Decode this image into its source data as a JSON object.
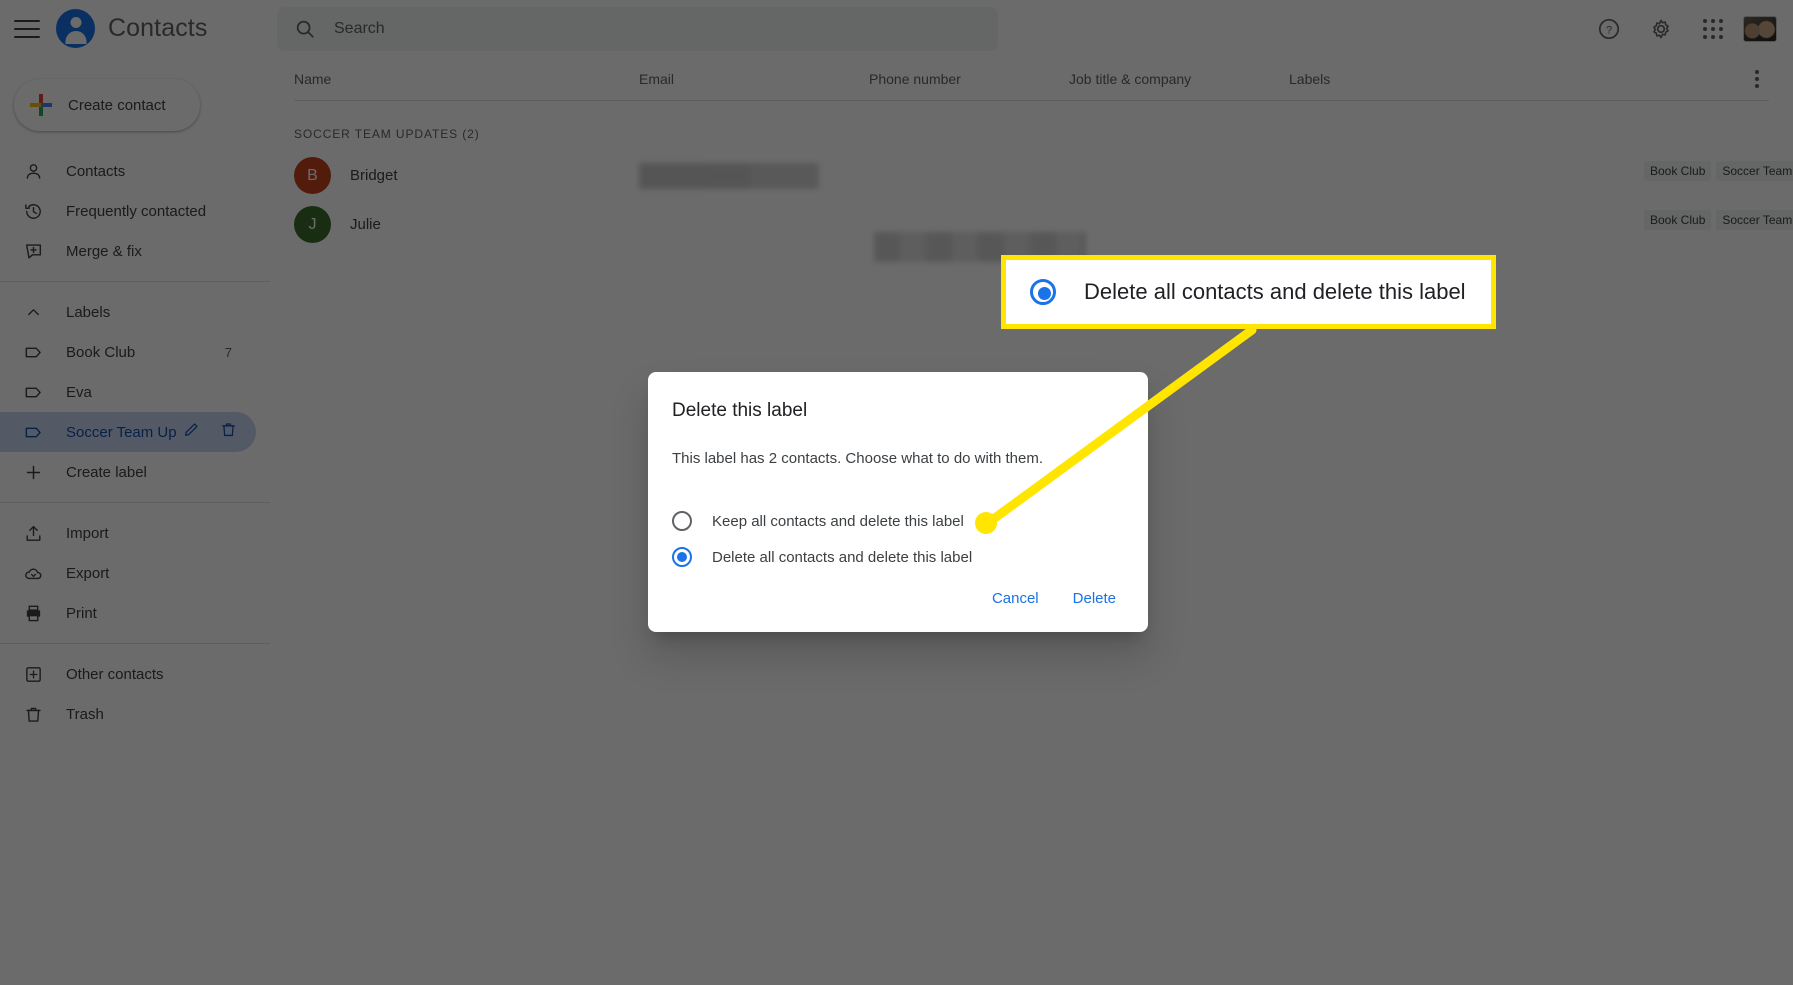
{
  "app": {
    "title": "Contacts",
    "menu_icon": "hamburger-icon",
    "logo_icon": "contacts-logo-icon"
  },
  "search": {
    "placeholder": "Search",
    "value": "",
    "icon": "search-icon"
  },
  "topbar_actions": [
    {
      "name": "help-icon",
      "label": "Help"
    },
    {
      "name": "settings-icon",
      "label": "Settings"
    },
    {
      "name": "google-apps-icon",
      "label": "Google apps"
    },
    {
      "name": "account-avatar",
      "label": "Google Account"
    }
  ],
  "sidebar": {
    "create_contact": {
      "label": "Create contact",
      "icon": "plus-icon"
    },
    "primary": [
      {
        "label": "Contacts",
        "icon": "person-icon",
        "selected": false
      },
      {
        "label": "Frequently contacted",
        "icon": "history-icon",
        "selected": false
      },
      {
        "label": "Merge & fix",
        "icon": "merge-icon",
        "selected": false
      }
    ],
    "labels_section": {
      "label": "Labels",
      "icon": "chevron-up-icon"
    },
    "labels": [
      {
        "label": "Book Club",
        "icon": "label-icon",
        "count": "7",
        "selected": false
      },
      {
        "label": "Eva",
        "icon": "label-icon",
        "count": "",
        "selected": false
      },
      {
        "label": "Soccer Team Up",
        "icon": "label-icon",
        "count": "",
        "selected": true
      }
    ],
    "create_label": {
      "label": "Create label",
      "icon": "plus-icon"
    },
    "tools": [
      {
        "label": "Import",
        "icon": "import-icon"
      },
      {
        "label": "Export",
        "icon": "export-icon"
      },
      {
        "label": "Print",
        "icon": "print-icon"
      }
    ],
    "footer": [
      {
        "label": "Other contacts",
        "icon": "other-contacts-icon"
      },
      {
        "label": "Trash",
        "icon": "trash-icon"
      }
    ]
  },
  "table": {
    "columns": [
      {
        "label": "Name"
      },
      {
        "label": "Email"
      },
      {
        "label": "Phone number"
      },
      {
        "label": "Job title & company"
      },
      {
        "label": "Labels"
      }
    ],
    "more_icon": "more-vertical-icon",
    "group_header": "SOCCER TEAM UPDATES (2)",
    "rows": [
      {
        "name": "Bridget",
        "initial": "B",
        "avatar_color": "#c5411e",
        "email": "",
        "phone": "",
        "job": "",
        "chips": [
          "Book Club",
          "Soccer Team Updates"
        ]
      },
      {
        "name": "Julie",
        "initial": "J",
        "avatar_color": "#3c6b2f",
        "email": "",
        "phone": "",
        "job": "",
        "chips": [
          "Book Club",
          "Soccer Team Updates"
        ]
      }
    ]
  },
  "dialog": {
    "title": "Delete this label",
    "description": "This label has 2 contacts. Choose what to do with them.",
    "options": [
      {
        "label": "Keep all contacts and delete this label",
        "selected": false
      },
      {
        "label": "Delete all contacts and delete this label",
        "selected": true
      }
    ],
    "cancel_label": "Cancel",
    "confirm_label": "Delete"
  },
  "annotation": {
    "callout_label": "Delete all contacts and delete this label",
    "border_color": "#ffe500",
    "line_color": "#ffe500"
  },
  "colors": {
    "accent": "#1a73e8",
    "text_primary": "#3c4043",
    "text_secondary": "#5f6368",
    "selected_bg": "#c5d7f2",
    "selected_text": "#174ea6",
    "highlight": "#ffe500"
  }
}
